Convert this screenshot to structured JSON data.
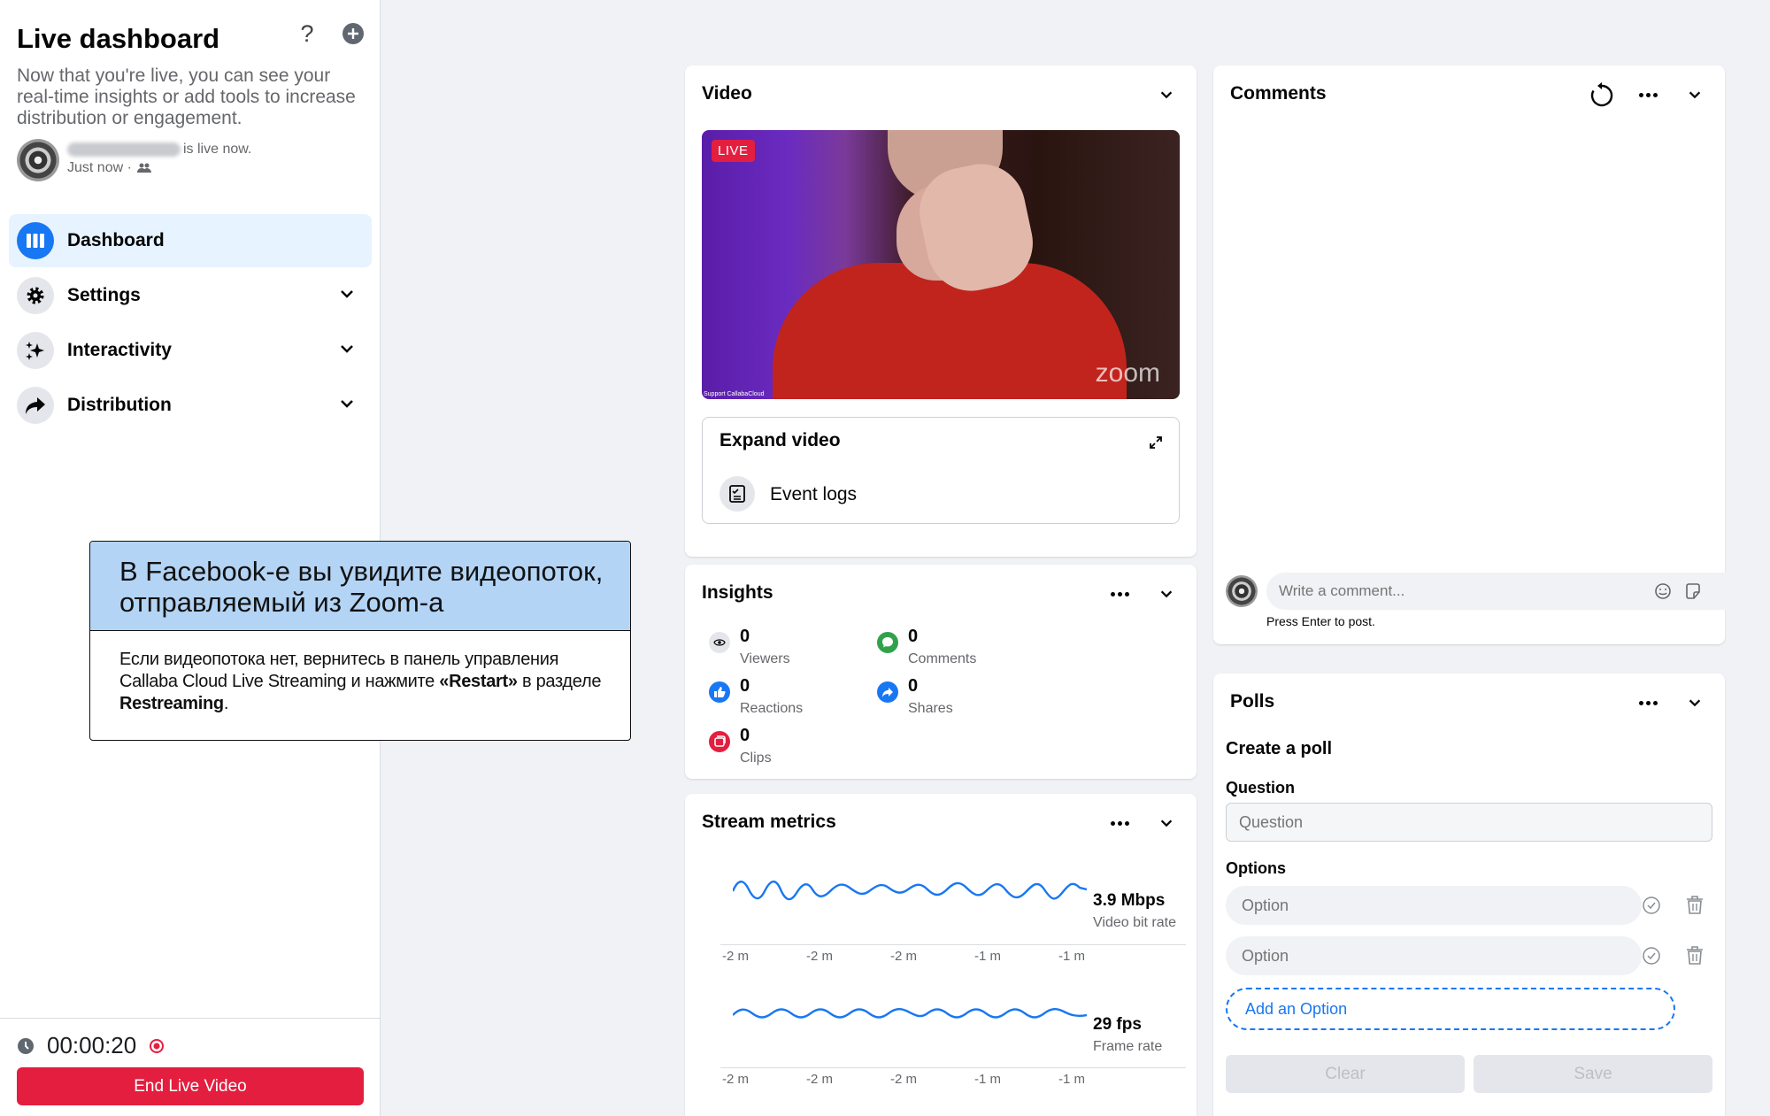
{
  "sidebar": {
    "title": "Live dashboard",
    "description": "Now that you're live, you can see your real-time insights or add tools to increase distribution or engagement.",
    "status": "is live now.",
    "time": "Just now ·",
    "nav": [
      {
        "label": "Dashboard",
        "icon": "dashboard-icon",
        "active": true
      },
      {
        "label": "Settings",
        "icon": "gear-icon"
      },
      {
        "label": "Interactivity",
        "icon": "sparkle-icon"
      },
      {
        "label": "Distribution",
        "icon": "share-arrow-icon"
      }
    ],
    "timer": "00:00:20",
    "end_button": "End Live Video"
  },
  "callout": {
    "heading": "В Facebook-е вы увидите видеопоток, отправляемый из Zoom-а",
    "body_before": "Если видеопотока нет, вернитесь в панель управления Callaba Cloud Live Streaming и нажмите ",
    "body_strong": "«Restart»",
    "body_middle": " в разделе ",
    "body_section": "Restreaming",
    "body_end": "."
  },
  "video": {
    "title": "Video",
    "live_badge": "LIVE",
    "watermark": "zoom",
    "support_label": "Support CallabaCloud",
    "expand_label": "Expand video",
    "event_logs_label": "Event logs"
  },
  "insights": {
    "title": "Insights",
    "items": [
      {
        "value": "0",
        "label": "Viewers",
        "icon": "eye-icon"
      },
      {
        "value": "0",
        "label": "Comments",
        "icon": "comment-icon"
      },
      {
        "value": "0",
        "label": "Reactions",
        "icon": "like-icon"
      },
      {
        "value": "0",
        "label": "Shares",
        "icon": "share-icon"
      },
      {
        "value": "0",
        "label": "Clips",
        "icon": "clip-icon"
      }
    ]
  },
  "stream_metrics": {
    "title": "Stream metrics",
    "bitrate": {
      "value": "3.9 Mbps",
      "label": "Video bit rate"
    },
    "framerate": {
      "value": "29 fps",
      "label": "Frame rate"
    },
    "ticks": [
      "-2 m",
      "-2 m",
      "-2 m",
      "-1 m",
      "-1 m"
    ]
  },
  "comments": {
    "title": "Comments",
    "placeholder": "Write a comment...",
    "hint": "Press Enter to post."
  },
  "polls": {
    "title": "Polls",
    "heading": "Create a poll",
    "question_label": "Question",
    "question_placeholder": "Question",
    "options_label": "Options",
    "option_placeholder": "Option",
    "add_option": "Add an Option",
    "clear": "Clear",
    "save": "Save"
  },
  "colors": {
    "accent": "#1877f2",
    "live_red": "#e41e3f",
    "callout_head": "#b3d4f5"
  }
}
